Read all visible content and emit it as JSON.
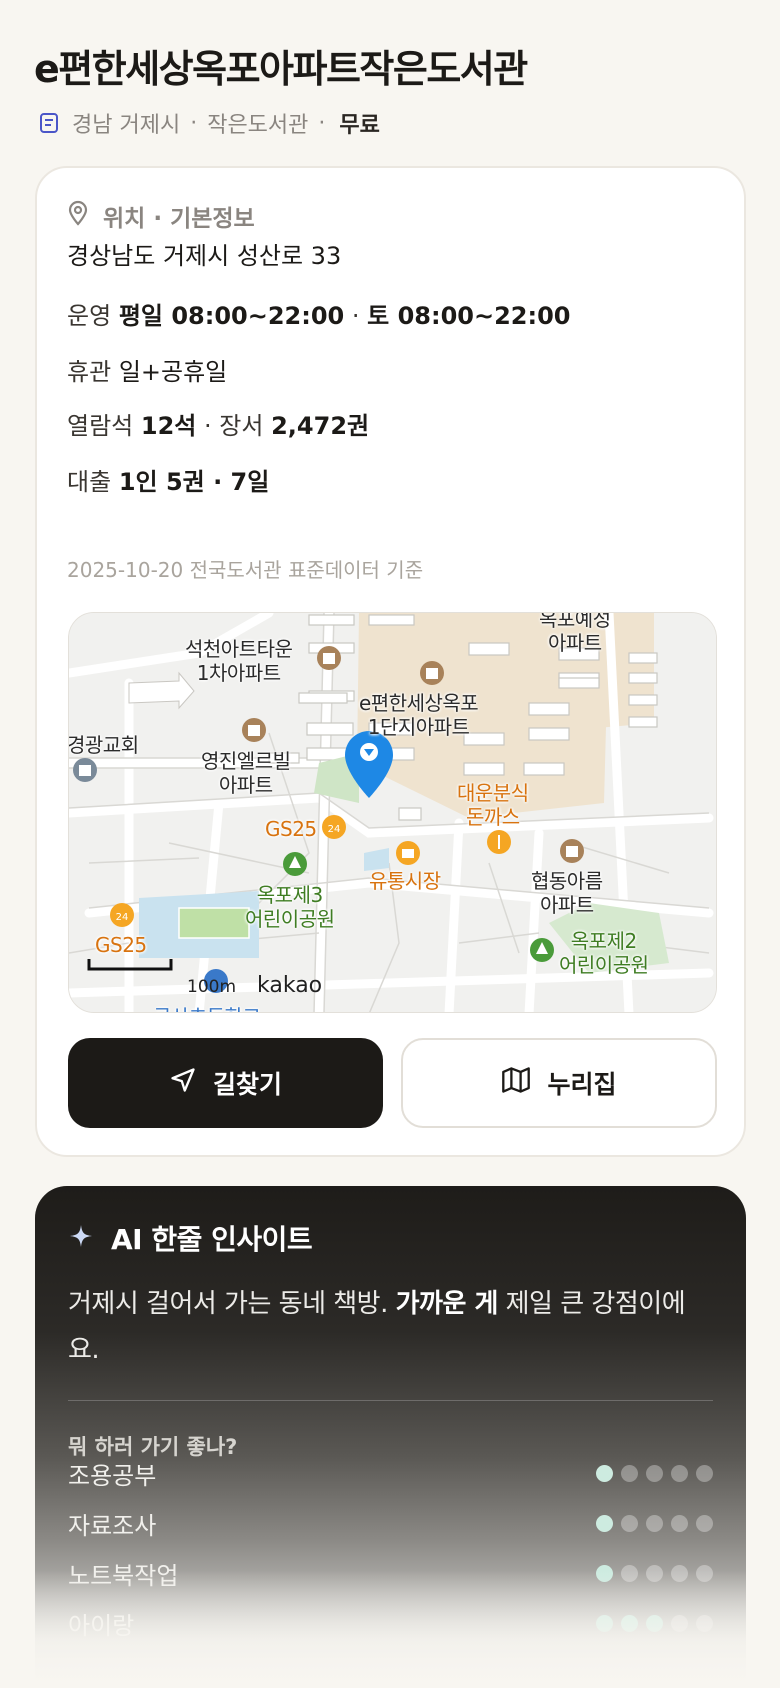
{
  "header": {
    "title": "e편한세상옥포아파트작은도서관",
    "region": "경남 거제시",
    "category": "작은도서관",
    "fee": "무료",
    "icon": "document-icon"
  },
  "info": {
    "section_title": "위치 · 기본정보",
    "section_icon": "location-pin-icon",
    "address": "경상남도 거제시 성산로 33",
    "hours_label": "운영",
    "hours_weekday": "평일 08:00~22:00",
    "hours_saturday": "토 08:00~22:00",
    "closed_label": "휴관",
    "closed_value": "일+공휴일",
    "seats_label": "열람석",
    "seats_value": "12석",
    "books_label": "장서",
    "books_value": "2,472권",
    "loan_label": "대출",
    "loan_value": "1인 5권 · 7일",
    "basis": "2025-10-20 전국도서관 표준데이터 기준"
  },
  "map": {
    "labels": {
      "seokcheon": "석천아트타운\n1차아파트",
      "ehan": "e편한세상옥포\n1단지아파트",
      "okpo_top": "옥포예성\n아파트",
      "church": "경광교회",
      "youngjin": "영진엘르빌\n아파트",
      "daewoon": "대운분식\n돈까스",
      "gs25_a": "GS25",
      "gs25_b": "GS25",
      "yutong": "유통시장",
      "park3": "옥포제3\n어린이공원",
      "hyupdong": "협동아름\n아파트",
      "park2": "옥포제2\n어린이공원",
      "bottom": "국산초등학교"
    },
    "scale": "100m",
    "logo": "kakao"
  },
  "actions": {
    "directions_label": "길찾기",
    "directions_icon": "navigation-arrow-icon",
    "nurijip_label": "누리집",
    "nurijip_icon": "map-icon"
  },
  "ai": {
    "title": "AI 한줄 인사이트",
    "icon": "sparkle-icon",
    "text_before": "거제시 걸어서 가는 동네 책방. ",
    "text_bold": "가까운 게",
    "text_after": " 제일 큰 강점이에요.",
    "question": "뭐 하러 가기 좋나?",
    "activities": [
      {
        "name": "조용공부",
        "score": 1
      },
      {
        "name": "자료조사",
        "score": 1
      },
      {
        "name": "노트북작업",
        "score": 1
      },
      {
        "name": "아이랑",
        "score": 3
      }
    ],
    "max_score": 5,
    "accent": "#cdebe0"
  }
}
